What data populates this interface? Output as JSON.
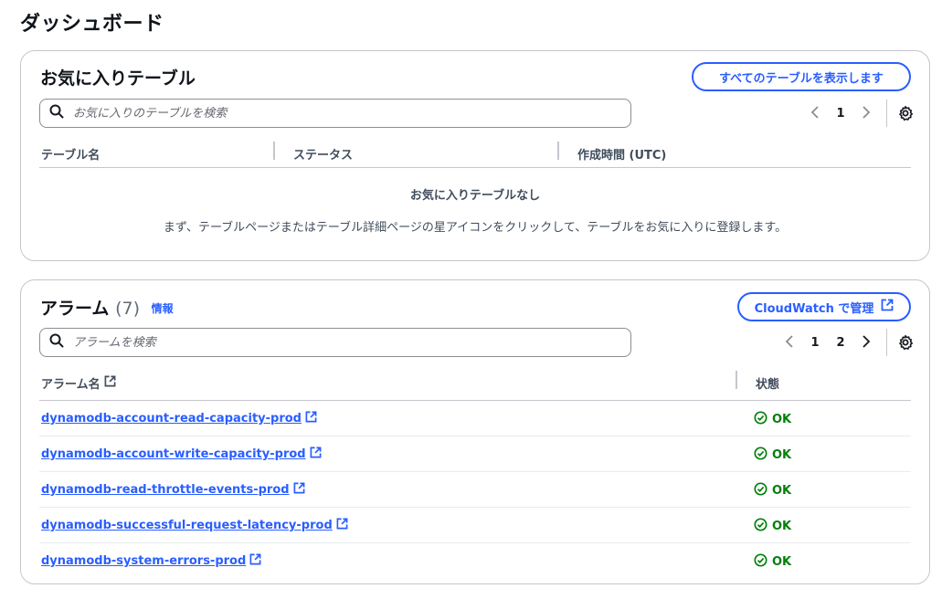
{
  "page": {
    "title": "ダッシュボード"
  },
  "favorites": {
    "title": "お気に入りテーブル",
    "view_all_label": "すべてのテーブルを表示します",
    "search_placeholder": "お気に入りのテーブルを検索",
    "pagination": {
      "pages": [
        "1"
      ]
    },
    "columns": [
      "テーブル名",
      "ステータス",
      "作成時間 (UTC)"
    ],
    "empty_title": "お気に入りテーブルなし",
    "empty_description": "まず、テーブルページまたはテーブル詳細ページの星アイコンをクリックして、テーブルをお気に入りに登録します。"
  },
  "alarms": {
    "title": "アラーム",
    "count": "(7)",
    "info_label": "情報",
    "manage_label": "CloudWatch で管理",
    "search_placeholder": "アラームを検索",
    "pagination": {
      "pages": [
        "1",
        "2"
      ]
    },
    "columns": [
      "アラーム名",
      "状態"
    ],
    "rows": [
      {
        "name": "dynamodb-account-read-capacity-prod",
        "status": "OK"
      },
      {
        "name": "dynamodb-account-write-capacity-prod",
        "status": "OK"
      },
      {
        "name": "dynamodb-read-throttle-events-prod",
        "status": "OK"
      },
      {
        "name": "dynamodb-successful-request-latency-prod",
        "status": "OK"
      },
      {
        "name": "dynamodb-system-errors-prod",
        "status": "OK"
      }
    ]
  },
  "icons": {
    "search": "search-icon",
    "settings": "gear-icon",
    "external": "external-link-icon",
    "status_ok": "check-circle-icon"
  },
  "colors": {
    "link": "#295eff",
    "ok": "#037f0c",
    "border": "#c6c6cd"
  }
}
